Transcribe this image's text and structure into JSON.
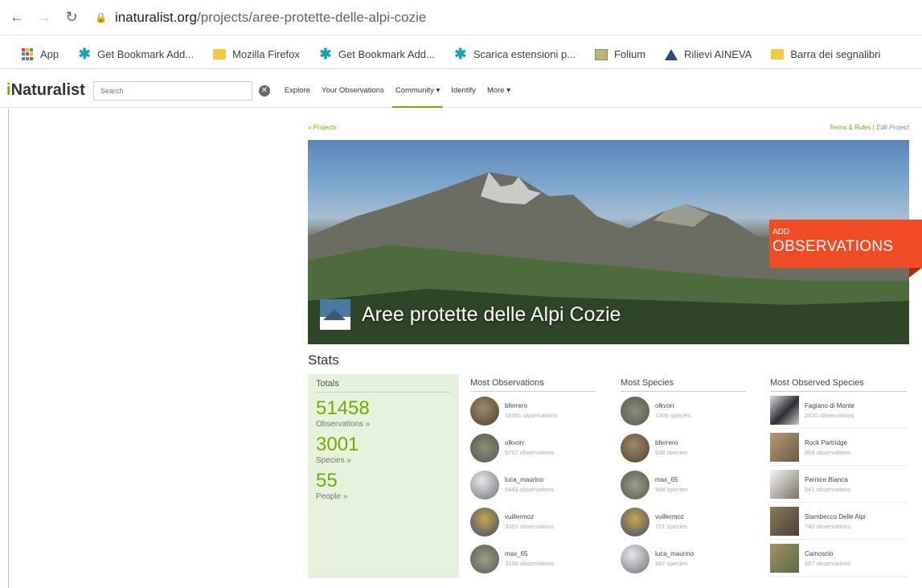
{
  "browser": {
    "url_host": "inaturalist.org",
    "url_path": "/projects/aree-protette-delle-alpi-cozie"
  },
  "bookmarks": [
    {
      "label": "App",
      "icon": "apps-grid-icon"
    },
    {
      "label": "Get Bookmark Add...",
      "icon": "puzzle-star-icon"
    },
    {
      "label": "Mozilla Firefox",
      "icon": "folder-icon"
    },
    {
      "label": "Get Bookmark Add...",
      "icon": "puzzle-star-icon"
    },
    {
      "label": "Scarica estensioni p...",
      "icon": "puzzle-star-icon"
    },
    {
      "label": "Folium",
      "icon": "image-icon"
    },
    {
      "label": "Rilievi AINEVA",
      "icon": "mountain-icon"
    },
    {
      "label": "Barra dei segnalibri",
      "icon": "folder-icon"
    }
  ],
  "header": {
    "logo": "Naturalist",
    "logo_i": "i",
    "search_placeholder": "Search",
    "nav": [
      "Explore",
      "Your Observations",
      "Community ▾",
      "Identify",
      "More ▾"
    ]
  },
  "project": {
    "breadcrumb": "« Projects",
    "terms": "Terms & Rules",
    "edit": "Edit Project",
    "title": "Aree protette delle Alpi Cozie",
    "add_small": "ADD",
    "add_big": "OBSERVATIONS"
  },
  "stats": {
    "heading": "Stats",
    "totals_heading": "Totals",
    "observations": "51458",
    "observations_label": "Observations »",
    "species": "3001",
    "species_label": "Species »",
    "people": "55",
    "people_label": "People »"
  },
  "most_observations": {
    "heading": "Most Observations",
    "rows": [
      {
        "name": "bferrero",
        "count": "18351 observations"
      },
      {
        "name": "olkvorr",
        "count": "9707 observations"
      },
      {
        "name": "luca_maurino",
        "count": "5843 observations"
      },
      {
        "name": "vuillermoz",
        "count": "3392 observations"
      },
      {
        "name": "max_65",
        "count": "3106 observations"
      }
    ]
  },
  "most_species": {
    "heading": "Most Species",
    "rows": [
      {
        "name": "olkvorr",
        "count": "1306 species"
      },
      {
        "name": "bferrero",
        "count": "938 species"
      },
      {
        "name": "max_65",
        "count": "908 species"
      },
      {
        "name": "vuillermoz",
        "count": "721 species"
      },
      {
        "name": "luca_maurino",
        "count": "487 species"
      }
    ]
  },
  "most_observed_species": {
    "heading": "Most Observed Species",
    "rows": [
      {
        "name": "Fagiano di Monte",
        "count": "2470 observations"
      },
      {
        "name": "Rock Partridge",
        "count": "869 observations"
      },
      {
        "name": "Pernice Bianca",
        "count": "841 observations"
      },
      {
        "name": "Stambecco Delle Alpi",
        "count": "740 observations"
      },
      {
        "name": "Camoscio",
        "count": "687 observations"
      }
    ]
  },
  "colors": {
    "brand_green": "#74ac00",
    "add_button": "#ef4b24",
    "totals_bg": "#e6f2dc"
  }
}
